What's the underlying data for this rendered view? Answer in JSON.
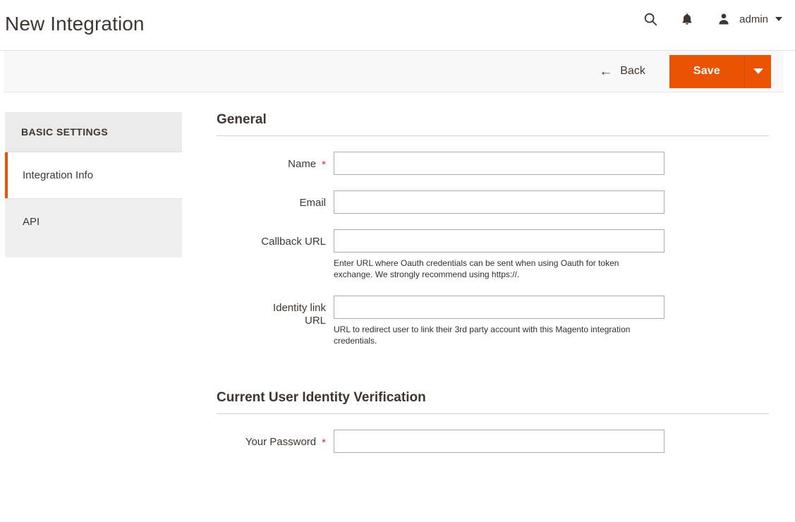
{
  "header": {
    "title": "New Integration",
    "search_icon": "search-icon",
    "notifications_icon": "bell-icon",
    "avatar_icon": "user-icon",
    "admin_label": "admin",
    "caret_icon": "chevron-down-icon"
  },
  "toolbar": {
    "back_label": "Back",
    "back_arrow": "←",
    "save_label": "Save",
    "save_toggle_icon": "chevron-down-icon",
    "accent_color": "#eb5202"
  },
  "sidebar": {
    "heading": "BASIC SETTINGS",
    "items": [
      {
        "label": "Integration Info",
        "active": true
      },
      {
        "label": "API",
        "active": false
      }
    ]
  },
  "main": {
    "sections": [
      {
        "title": "General",
        "fields": [
          {
            "label": "Name",
            "required": true,
            "value": "",
            "note": ""
          },
          {
            "label": "Email",
            "required": false,
            "value": "",
            "note": ""
          },
          {
            "label": "Callback URL",
            "required": false,
            "value": "",
            "note": "Enter URL where Oauth credentials can be sent when using Oauth for token exchange. We strongly recommend using https://."
          },
          {
            "label": "Identity link URL",
            "required": false,
            "value": "",
            "note": "URL to redirect user to link their 3rd party account with this Magento integration credentials."
          }
        ]
      },
      {
        "title": "Current User Identity Verification",
        "fields": [
          {
            "label": "Your Password",
            "required": true,
            "value": "",
            "note": ""
          }
        ]
      }
    ],
    "required_marker": "*"
  }
}
